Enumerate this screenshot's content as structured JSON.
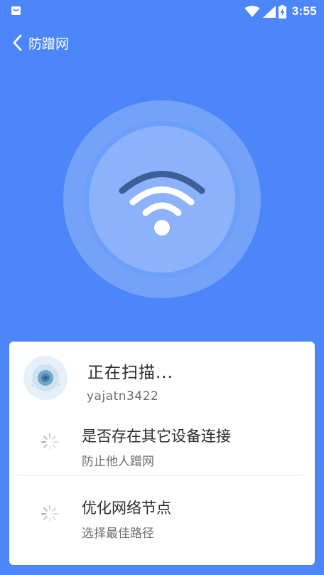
{
  "status_bar": {
    "time": "3:55",
    "icons": [
      "notification-icon",
      "wifi-icon",
      "cell-signal-icon",
      "battery-charging-icon"
    ]
  },
  "header": {
    "back_icon": "chevron-left-icon",
    "title": "防蹭网"
  },
  "hero": {
    "icon": "wifi-icon"
  },
  "scan_card": {
    "title": "正在扫描...",
    "subtitle": "yajatn3422",
    "tasks": [
      {
        "title": "是否存在其它设备连接",
        "description": "防止他人蹭网",
        "icon": "loading-spinner-icon"
      },
      {
        "title": "优化网络节点",
        "description": "选择最佳路径",
        "icon": "loading-spinner-icon"
      }
    ]
  },
  "colors": {
    "background": "#4c86f8",
    "wifi_arc_outer": "#3c5f97",
    "card": "#ffffff",
    "text_primary": "#2b2b2b",
    "text_secondary": "#6d6d6d"
  }
}
